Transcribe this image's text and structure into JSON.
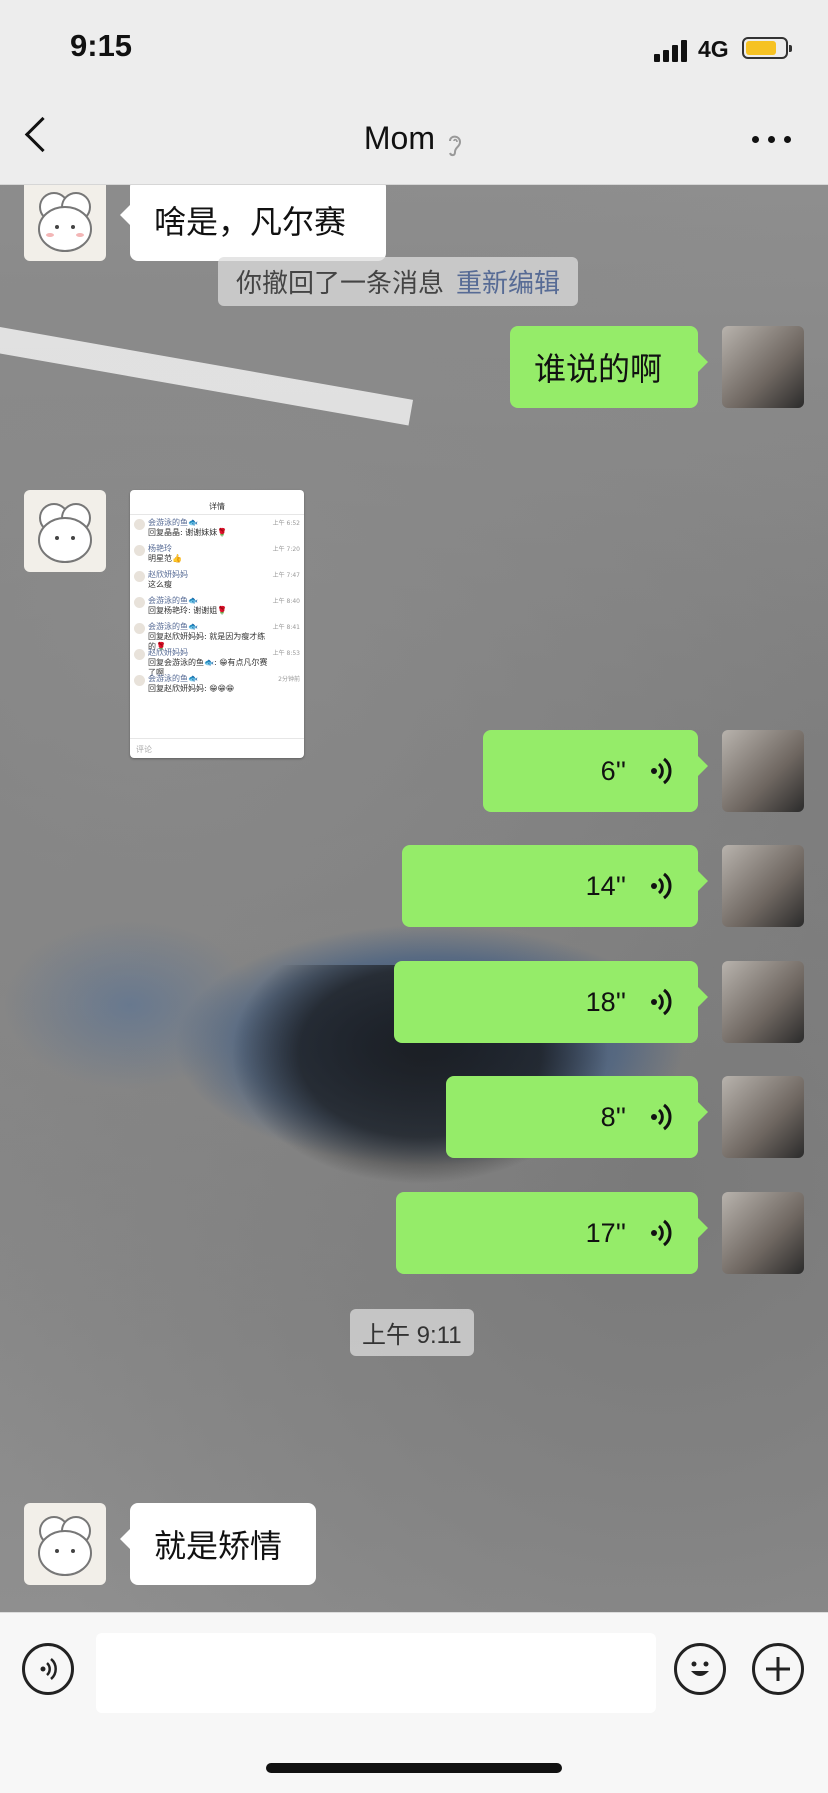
{
  "status": {
    "time": "9:15",
    "network": "4G",
    "battery_color": "#f6c223"
  },
  "nav": {
    "title": "Mom",
    "back_icon": "chevron-left-icon",
    "ear_icon": "ear-icon",
    "more_icon": "more-icon"
  },
  "messages": {
    "m1": {
      "side": "left",
      "text": "啥是，凡尔赛"
    },
    "recall": {
      "text": "你撤回了一条消息",
      "link": "重新编辑"
    },
    "m2": {
      "side": "right",
      "text": "谁说的啊"
    },
    "screenshot": {
      "header": "详情",
      "rows": [
        {
          "name": "会游泳的鱼🐟",
          "text": "回复晶晶: 谢谢妹妹🌹",
          "time": "上午 6:52"
        },
        {
          "name": "杨艳玲",
          "text": "明星范👍",
          "time": "上午 7:20"
        },
        {
          "name": "赵欣妍妈妈",
          "text": "这么瘦",
          "time": "上午 7:47"
        },
        {
          "name": "会游泳的鱼🐟",
          "text": "回复杨艳玲: 谢谢姐🌹",
          "time": "上午 8:40"
        },
        {
          "name": "会游泳的鱼🐟",
          "text": "回复赵欣妍妈妈: 就是因为瘦才练的🌹",
          "time": "上午 8:41"
        },
        {
          "name": "赵欣妍妈妈",
          "text": "回复会游泳的鱼🐟: 😁有点凡尔赛了啊",
          "time": "上午 8:53"
        },
        {
          "name": "会游泳的鱼🐟",
          "text": "回复赵欣妍妈妈: 😁😁😁",
          "time": "2分钟前"
        }
      ],
      "footer": "评论"
    },
    "voices": [
      "6''",
      "14''",
      "18''",
      "8''",
      "17''"
    ],
    "timestamp": "上午 9:11",
    "m3": {
      "side": "left",
      "text": "就是矫情"
    }
  },
  "input": {
    "voice_icon": "voice-icon",
    "emoji_icon": "emoji-icon",
    "plus_icon": "plus-icon",
    "placeholder": ""
  },
  "colors": {
    "bubble_green": "#95ec69",
    "bubble_white": "#ffffff",
    "link": "#576b95"
  }
}
